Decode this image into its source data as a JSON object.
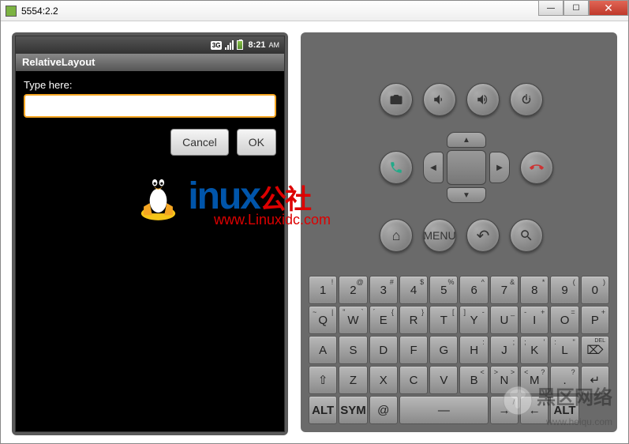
{
  "window": {
    "title": "5554:2.2"
  },
  "status": {
    "network": "3G",
    "time": "8:21",
    "ampm": "AM"
  },
  "app": {
    "title": "RelativeLayout",
    "label": "Type here:",
    "input_value": "",
    "cancel_label": "Cancel",
    "ok_label": "OK"
  },
  "controls": {
    "home": "⌂",
    "menu": "MENU",
    "back": "↶",
    "search": "🔍"
  },
  "keyboard": {
    "row1": [
      {
        "m": "1",
        "s": "!"
      },
      {
        "m": "2",
        "s": "@"
      },
      {
        "m": "3",
        "s": "#"
      },
      {
        "m": "4",
        "s": "$"
      },
      {
        "m": "5",
        "s": "%"
      },
      {
        "m": "6",
        "s": "^"
      },
      {
        "m": "7",
        "s": "&"
      },
      {
        "m": "8",
        "s": "*"
      },
      {
        "m": "9",
        "s": "("
      },
      {
        "m": "0",
        "s": ")"
      }
    ],
    "row2": [
      {
        "m": "Q",
        "s": "|",
        "s2": "~"
      },
      {
        "m": "W",
        "s": "`",
        "s2": "\""
      },
      {
        "m": "E",
        "s": "{",
        "s2": "´"
      },
      {
        "m": "R",
        "s": "}"
      },
      {
        "m": "T",
        "s": "["
      },
      {
        "m": "Y",
        "s": "-",
        "s2": "]"
      },
      {
        "m": "U",
        "s": "_"
      },
      {
        "m": "I",
        "s": "+",
        "s2": "-"
      },
      {
        "m": "O",
        "s": "="
      },
      {
        "m": "P",
        "s": "+"
      }
    ],
    "row3": [
      {
        "m": "A"
      },
      {
        "m": "S"
      },
      {
        "m": "D"
      },
      {
        "m": "F"
      },
      {
        "m": "G"
      },
      {
        "m": "H",
        "s": ":"
      },
      {
        "m": "J",
        "s": ";"
      },
      {
        "m": "K",
        "s": "'",
        "s2": ";"
      },
      {
        "m": "L",
        "s": "\"",
        "s2": ":"
      },
      {
        "m": "DEL",
        "del": true
      }
    ],
    "row4": [
      {
        "m": "⇧"
      },
      {
        "m": "Z"
      },
      {
        "m": "X"
      },
      {
        "m": "C"
      },
      {
        "m": "V"
      },
      {
        "m": "B",
        "s": "<"
      },
      {
        "m": "N",
        "s": ">",
        "s2": ">"
      },
      {
        "m": "M",
        "s": "?",
        "s2": "<"
      },
      {
        "m": ".",
        "s": "?"
      },
      {
        "m": "↵",
        ",": true
      }
    ],
    "row5": {
      "alt": "ALT",
      "sym": "SYM",
      "at": "@",
      "space": "—",
      "slash": "/",
      "comma": ",",
      "alt2": "ALT"
    }
  },
  "watermark": {
    "text_black": "L",
    "text_blue": "inux",
    "text_red": "公社",
    "url": "www.Linuxidc.com",
    "wm2_text": "黑区网络",
    "wm2_url": "www.heiqu.com"
  }
}
